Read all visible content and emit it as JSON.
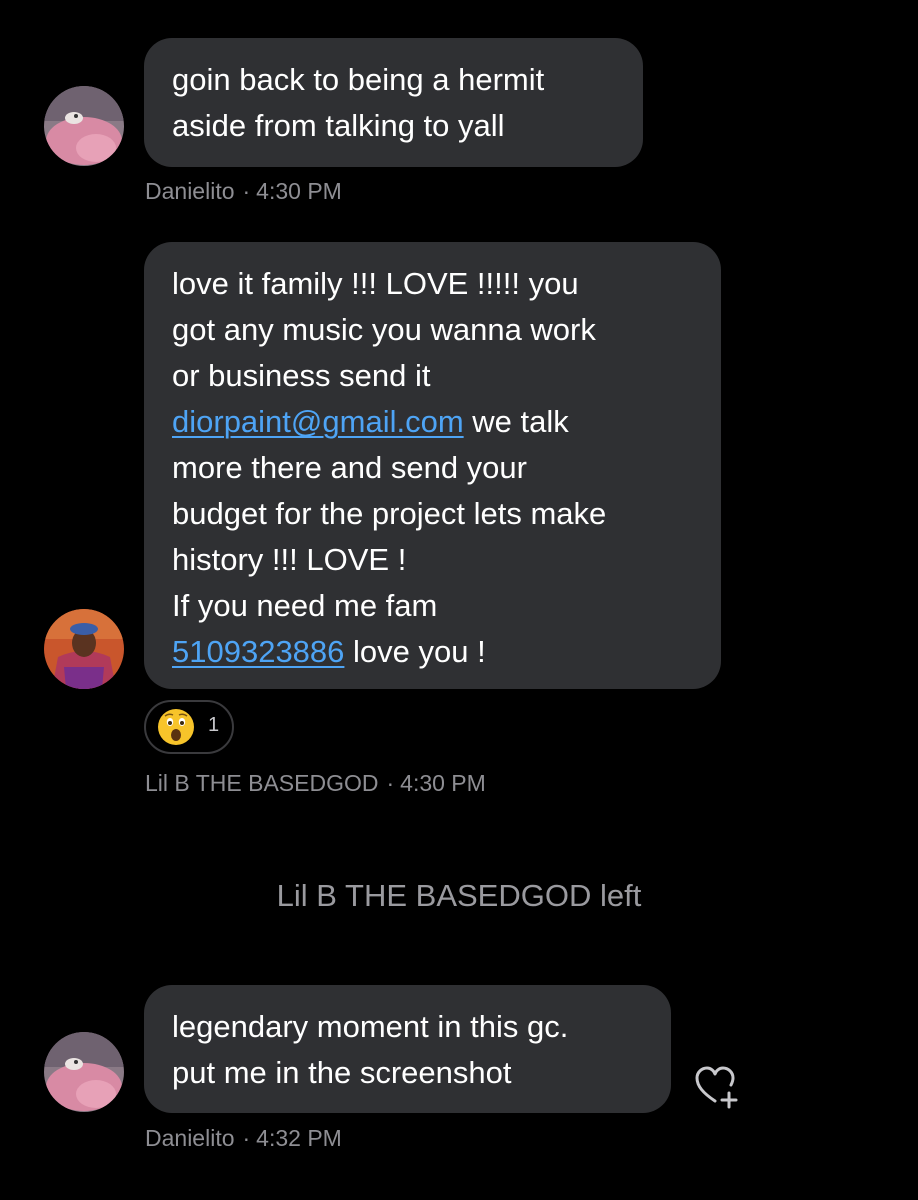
{
  "messages": [
    {
      "sender": "Danielito",
      "time": "4:30 PM",
      "lines": [
        "goin back to being a hermit",
        "aside from talking to yall"
      ]
    },
    {
      "sender": "Lil B THE BASEDGOD",
      "time": "4:30 PM",
      "lines": [
        "love it family !!! LOVE !!!!! you",
        "got any music you wanna work",
        "or business send it"
      ],
      "email_link": "diorpaint@gmail.com",
      "email_after": " we talk",
      "lines2": [
        "more there and send your",
        "budget for the project lets make",
        "history !!! LOVE !",
        "If you need me fam"
      ],
      "phone_link": "5109323886",
      "phone_after": " love you !",
      "reaction": {
        "emoji": "astonished-face",
        "count": "1"
      }
    },
    {
      "sender": "Danielito",
      "time": "4:32 PM",
      "lines": [
        "legendary moment in this gc.",
        "put me in the screenshot"
      ]
    }
  ],
  "system_event": "Lil B THE BASEDGOD left",
  "separator": "·",
  "colors": {
    "background": "#000000",
    "bubble": "#2f3033",
    "link": "#4ea4f5",
    "meta_text": "#8e8e93"
  }
}
